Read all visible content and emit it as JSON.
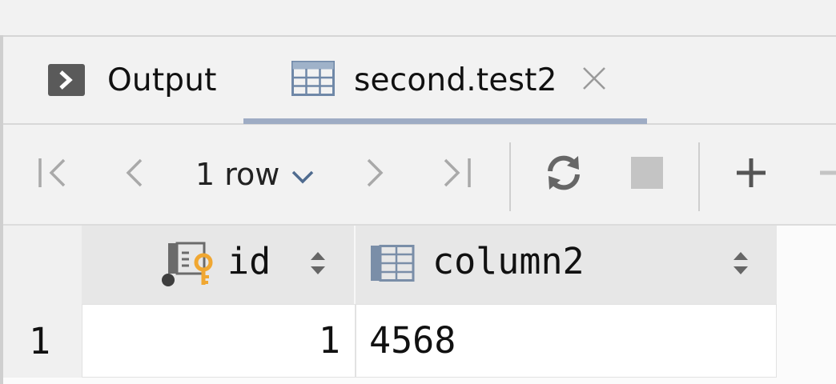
{
  "tabs": [
    {
      "label": "Output",
      "icon": "console-icon"
    },
    {
      "label": "second.test2",
      "icon": "table-icon",
      "closable": true
    }
  ],
  "active_tab": "second.test2",
  "toolbar": {
    "row_count_label": "1 row",
    "icons": [
      "first-page-icon",
      "previous-page-icon",
      "chevron-down-icon",
      "next-page-icon",
      "last-page-icon",
      "refresh-icon",
      "stop-icon",
      "add-row-icon",
      "delete-row-icon"
    ]
  },
  "grid": {
    "columns": [
      {
        "name": "id",
        "icon": "primary-key-column-icon",
        "sortable": true
      },
      {
        "name": "column2",
        "icon": "column-icon",
        "sortable": true
      }
    ],
    "rows": [
      {
        "row_number": "1",
        "cells": [
          "1",
          "4568"
        ]
      }
    ]
  },
  "colors": {
    "active_tab_underline": "#9eacc4",
    "key_icon": "#f0a732",
    "icon_gray": "#5a5a5a"
  }
}
